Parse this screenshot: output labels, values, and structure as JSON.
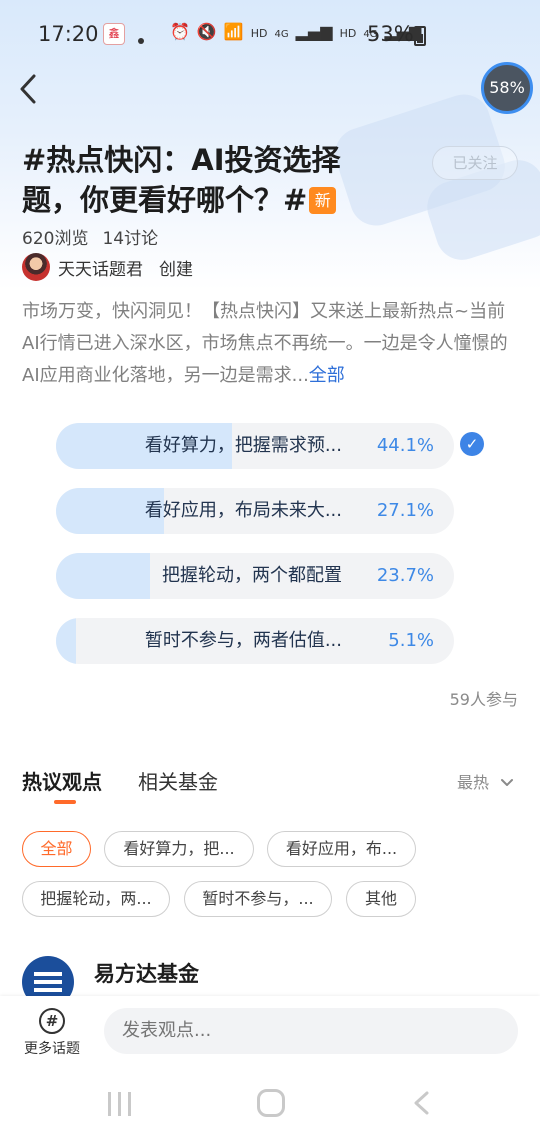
{
  "status_bar": {
    "time": "17:20",
    "app_icon_text": "鑫",
    "icons": [
      "alarm-icon",
      "mute-icon",
      "wifi-icon",
      "HD",
      "4G",
      "signal-icon",
      "HD",
      "4G",
      "signal-icon"
    ],
    "battery": "53%"
  },
  "nav": {
    "progress_badge": "58%"
  },
  "topic": {
    "title": "#热点快闪：AI投资选择题，你更看好哪个？#",
    "new_tag": "新",
    "follow_label": "已关注",
    "views": "620浏览",
    "discussions": "14讨论",
    "creator_name": "天天话题君",
    "creator_role": "创建",
    "description": "市场万变，快闪洞见！【热点快闪】又来送上最新热点~当前AI行情已进入深水区，市场焦点不再统一。一边是令人憧憬的AI应用商业化落地，另一边是需求...",
    "more_label": "全部"
  },
  "poll": {
    "options": [
      {
        "label": "看好算力，把握需求预...",
        "percent_text": "44.1%",
        "value": 0.441,
        "selected": true
      },
      {
        "label": "看好应用，布局未来大...",
        "percent_text": "27.1%",
        "value": 0.271,
        "selected": false
      },
      {
        "label": "把握轮动，两个都配置",
        "percent_text": "23.7%",
        "value": 0.237,
        "selected": false
      },
      {
        "label": "暂时不参与，两者估值...",
        "percent_text": "5.1%",
        "value": 0.051,
        "selected": false
      }
    ],
    "participants": "59人参与"
  },
  "tabs": {
    "items": [
      "热议观点",
      "相关基金"
    ],
    "sort_label": "最热"
  },
  "filters": {
    "chips": [
      "全部",
      "看好算力，把...",
      "看好应用，布...",
      "把握轮动，两...",
      "暂时不参与，...",
      "其他"
    ]
  },
  "post": {
    "author": "易方达基金"
  },
  "bottom": {
    "more_topics": "更多话题",
    "comment_placeholder": "发表观点..."
  },
  "colors": {
    "accent_orange": "#ff6a2a",
    "accent_blue": "#3e89e6",
    "poll_fill": "#d5e7fb"
  }
}
